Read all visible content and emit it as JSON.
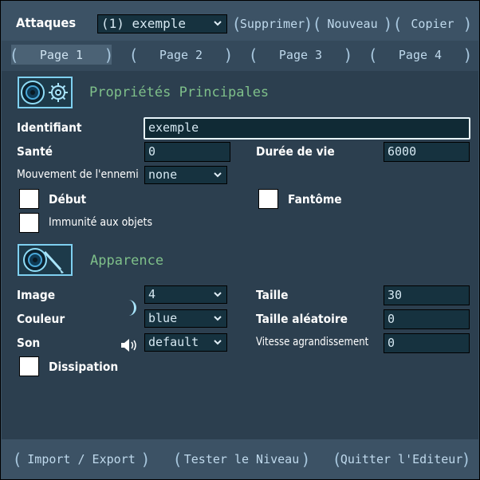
{
  "header": {
    "title": "Attaques",
    "attack_select": "(1) exemple",
    "delete_label": "Supprimer",
    "new_label": "Nouveau",
    "copy_label": "Copier"
  },
  "tabs": [
    {
      "label": "Page 1",
      "active": true
    },
    {
      "label": "Page 2",
      "active": false
    },
    {
      "label": "Page 3",
      "active": false
    },
    {
      "label": "Page 4",
      "active": false
    }
  ],
  "main_props": {
    "title": "Propriétés Principales",
    "icon": "spiral-gear-icon",
    "identifier_label": "Identifiant",
    "identifier_value": "exemple",
    "health_label": "Santé",
    "health_value": "0",
    "lifetime_label": "Durée de vie",
    "lifetime_value": "6000",
    "movement_label": "Mouvement de l'ennemi",
    "movement_value": "none",
    "start_label": "Début",
    "start_checked": false,
    "ghost_label": "Fantôme",
    "ghost_checked": false,
    "item_immunity_label": "Immunité aux objets",
    "item_immunity_checked": false
  },
  "appearance": {
    "title": "Apparence",
    "icon": "spiral-brush-icon",
    "image_label": "Image",
    "image_value": "4",
    "image_preview_icon": "crescent-icon",
    "size_label": "Taille",
    "size_value": "30",
    "color_label": "Couleur",
    "color_value": "blue",
    "random_size_label": "Taille aléatoire",
    "random_size_value": "0",
    "sound_label": "Son",
    "sound_icon": "speaker-icon",
    "sound_value": "default",
    "growth_speed_label": "Vitesse agrandissement",
    "growth_speed_value": "0",
    "dissipation_label": "Dissipation",
    "dissipation_checked": false
  },
  "footer": {
    "import_export_label": "Import / Export",
    "test_level_label": "Tester le Niveau",
    "quit_editor_label": "Quitter l'Editeur"
  },
  "colors": {
    "panel_bg": "#2c3f4f",
    "band_bg": "#3c5265",
    "field_bg": "#16323f",
    "section_title": "#7fc08a",
    "button_text": "#bfd9ec"
  }
}
